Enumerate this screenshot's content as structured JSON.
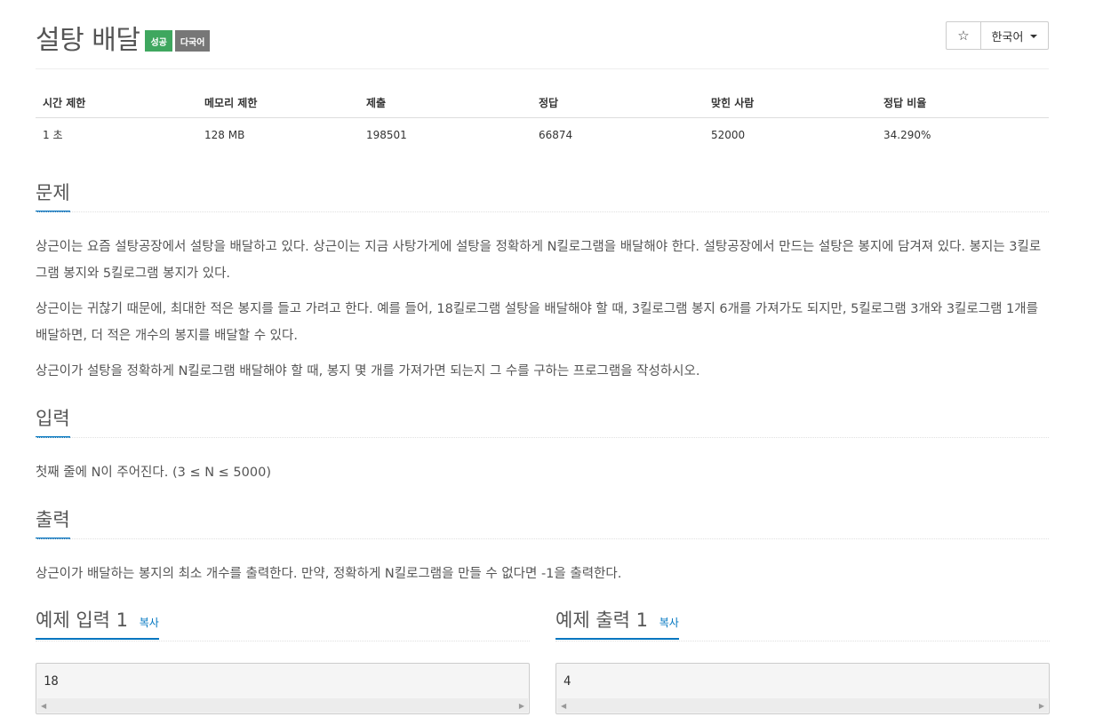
{
  "problem": {
    "title": "설탕 배달",
    "badge_success": "성공",
    "badge_multilang": "다국어"
  },
  "toolbar": {
    "star_glyph": "☆",
    "language": "한국어"
  },
  "info_table": {
    "headers": [
      "시간 제한",
      "메모리 제한",
      "제출",
      "정답",
      "맞힌 사람",
      "정답 비율"
    ],
    "values": [
      "1 초",
      "128 MB",
      "198501",
      "66874",
      "52000",
      "34.290%"
    ]
  },
  "sections": {
    "problem_title": "문제",
    "problem_paragraphs": [
      "상근이는 요즘 설탕공장에서 설탕을 배달하고 있다. 상근이는 지금 사탕가게에 설탕을 정확하게 N킬로그램을 배달해야 한다. 설탕공장에서 만드는 설탕은 봉지에 담겨져 있다. 봉지는 3킬로그램 봉지와 5킬로그램 봉지가 있다.",
      "상근이는 귀찮기 때문에, 최대한 적은 봉지를 들고 가려고 한다. 예를 들어, 18킬로그램 설탕을 배달해야 할 때, 3킬로그램 봉지 6개를 가져가도 되지만, 5킬로그램 3개와 3킬로그램 1개를 배달하면, 더 적은 개수의 봉지를 배달할 수 있다.",
      "상근이가 설탕을 정확하게 N킬로그램 배달해야 할 때, 봉지 몇 개를 가져가면 되는지 그 수를 구하는 프로그램을 작성하시오."
    ],
    "input_title": "입력",
    "input_text": "첫째 줄에 N이 주어진다. (3 ≤ N ≤ 5000)",
    "output_title": "출력",
    "output_text": "상근이가 배달하는 봉지의 최소 개수를 출력한다. 만약, 정확하게 N킬로그램을 만들 수 없다면 -1을 출력한다."
  },
  "examples": {
    "input_title": "예제 입력 1",
    "output_title": "예제 출력 1",
    "copy_label": "복사",
    "input_value": "18",
    "output_value": "4"
  }
}
